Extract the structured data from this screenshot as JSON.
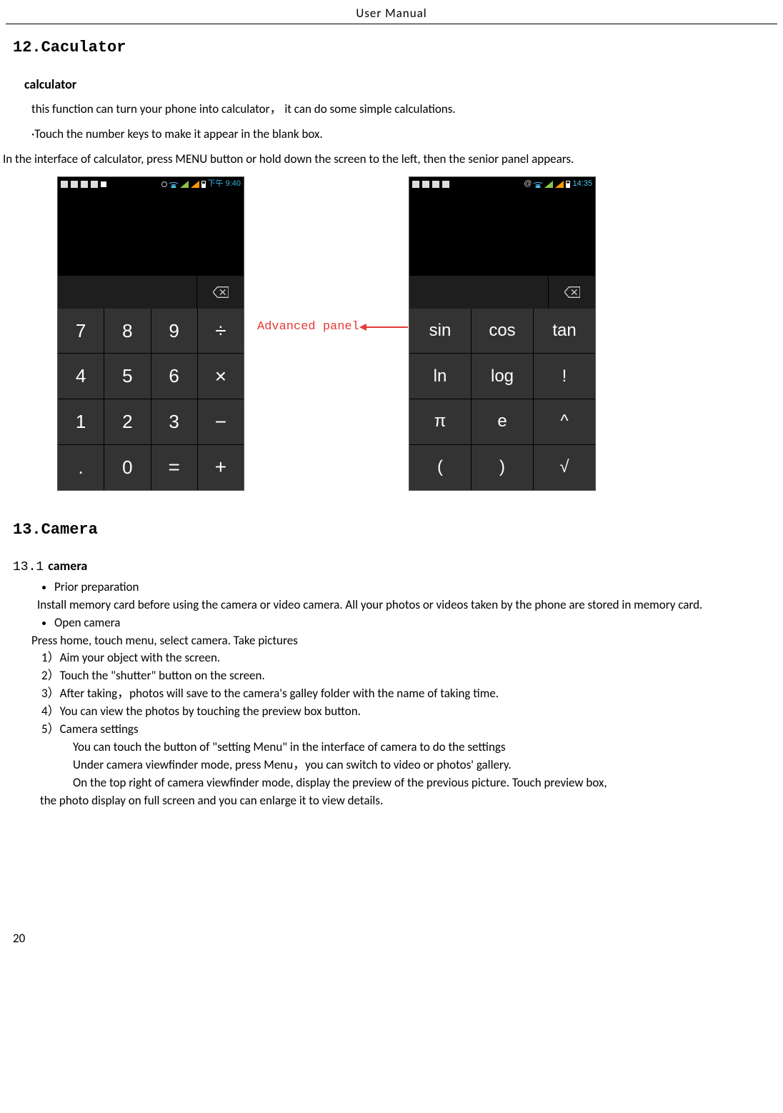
{
  "header": "User    Manual",
  "section12": {
    "heading": "12.Caculator",
    "sub": "calculator",
    "p1": "this function can turn your phone into calculator，  it can do some simple calculations.",
    "p2": "·Touch the number keys to make it appear in the blank box.",
    "p3": "In the interface of calculator, press MENU button or hold down the screen to the left, then the senior panel appears."
  },
  "screenshots": {
    "left": {
      "time": "下午 9:40",
      "keys": [
        "7",
        "8",
        "9",
        "÷",
        "4",
        "5",
        "6",
        "×",
        "1",
        "2",
        "3",
        "−",
        ".",
        "0",
        "=",
        "+"
      ]
    },
    "right": {
      "time": "14:35",
      "keys": [
        "sin",
        "cos",
        "tan",
        "ln",
        "log",
        "!",
        "π",
        "e",
        "^",
        "(",
        ")",
        "√"
      ]
    },
    "annotation": "Advanced panel"
  },
  "section13": {
    "heading": "13.Camera",
    "sub_num": "13.1",
    "sub_label": "camera",
    "bullet1": "Prior preparation",
    "bullet1_p": "Install memory card before using the camera or video camera. All your photos or videos taken by the phone are stored in memory card.",
    "bullet2": "Open camera",
    "open_p": "Press home, touch menu, select camera. Take pictures",
    "n1": "1）Aim your object with the screen.",
    "n2": "2）Touch the \"shutter\" button on the screen.",
    "n3": "3）After taking，photos will save to the camera's galley folder with the name of taking time.",
    "n4": "4）You can view the photos by touching the preview box button.",
    "n5": "5）Camera settings",
    "s1": "You can touch the button of \"setting Menu\" in the interface of camera to do the settings",
    "s2": "Under camera viewfinder mode, press Menu，you can switch to video or photos' gallery.",
    "s3_a": "On the top right of camera viewfinder mode, display the preview of the previous picture. Touch preview box,",
    "s3_b": "the photo display on full screen and you can enlarge it to view details."
  },
  "page_number": "20"
}
